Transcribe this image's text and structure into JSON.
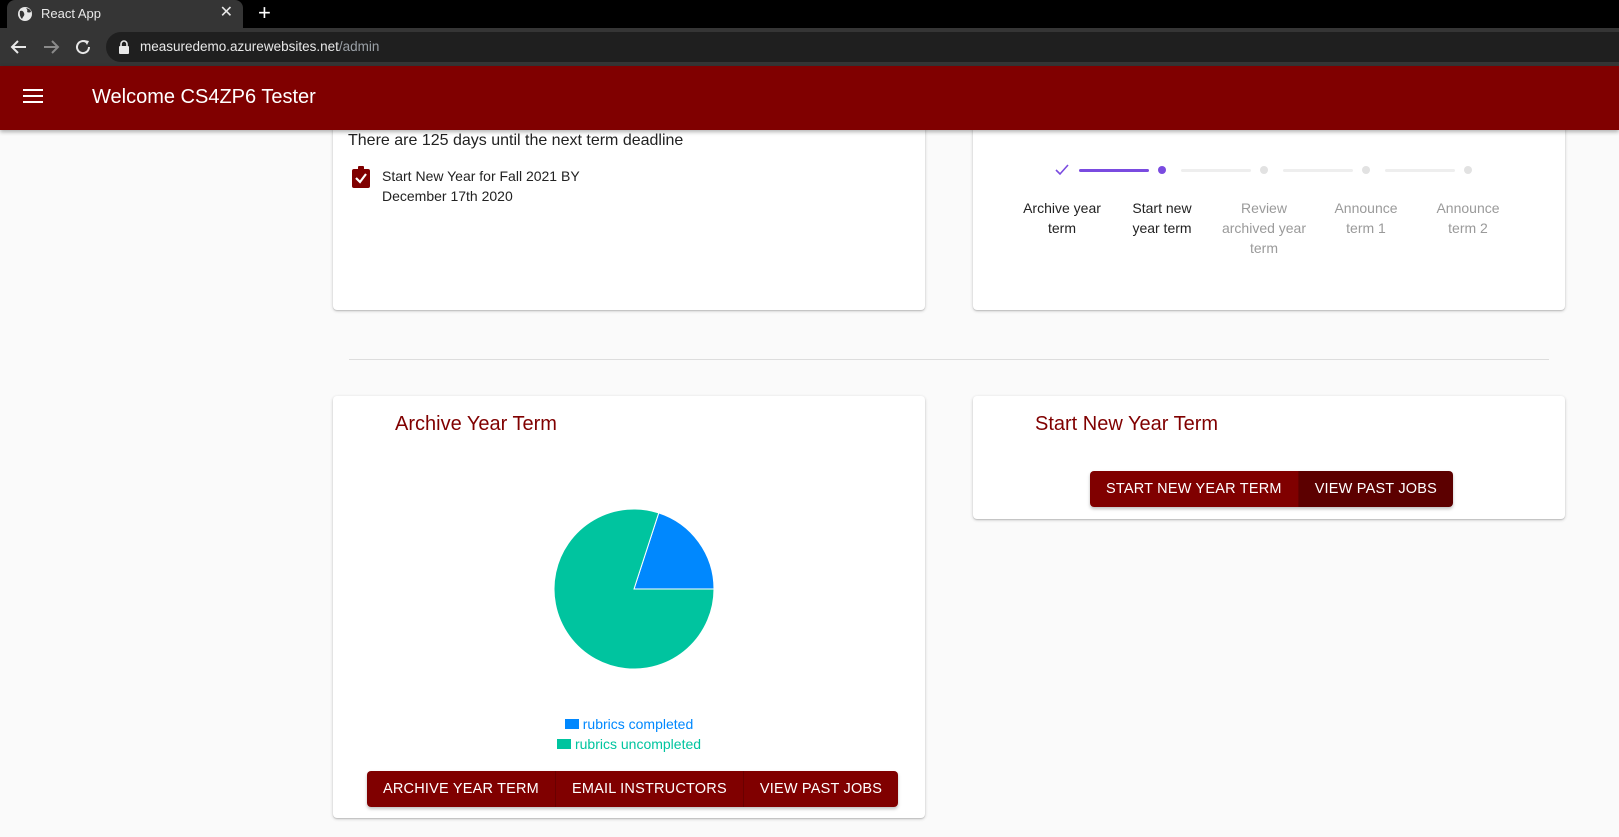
{
  "browser": {
    "tab_title": "React App",
    "tab_close": "✕",
    "new_tab": "+",
    "url_host": "measuredemo.azurewebsites.net",
    "url_path": "/admin"
  },
  "header": {
    "title": "Welcome CS4ZP6 Tester"
  },
  "deadline": {
    "text": "There are 125 days until the next term deadline",
    "task_line1": "Start New Year for Fall 2021 BY",
    "task_line2": "December 17th 2020"
  },
  "stepper": {
    "steps": [
      {
        "line1": "Archive year",
        "line2": "term",
        "line3": "",
        "state": "completed"
      },
      {
        "line1": "Start new",
        "line2": "year term",
        "line3": "",
        "state": "active"
      },
      {
        "line1": "Review",
        "line2": "archived year",
        "line3": "term",
        "state": "pending"
      },
      {
        "line1": "Announce",
        "line2": "term 1",
        "line3": "",
        "state": "pending"
      },
      {
        "line1": "Announce",
        "line2": "term 2",
        "line3": "",
        "state": "pending"
      }
    ]
  },
  "archive_card": {
    "title": "Archive Year Term",
    "buttons": {
      "archive": "ARCHIVE YEAR TERM",
      "email": "EMAIL INSTRUCTORS",
      "past_jobs": "VIEW PAST JOBS"
    }
  },
  "new_year_card": {
    "title": "Start New Year Term",
    "buttons": {
      "start": "START NEW YEAR TERM",
      "past_jobs": "VIEW PAST JOBS"
    }
  },
  "chart_data": {
    "type": "pie",
    "categories": [
      "rubrics completed",
      "rubrics uncompleted"
    ],
    "values": [
      20,
      80
    ],
    "colors": [
      "#0088fe",
      "#00c49f"
    ],
    "legend": "bottom"
  },
  "colors": {
    "brand": "#800000",
    "stepper_accent": "#7a4be0"
  }
}
